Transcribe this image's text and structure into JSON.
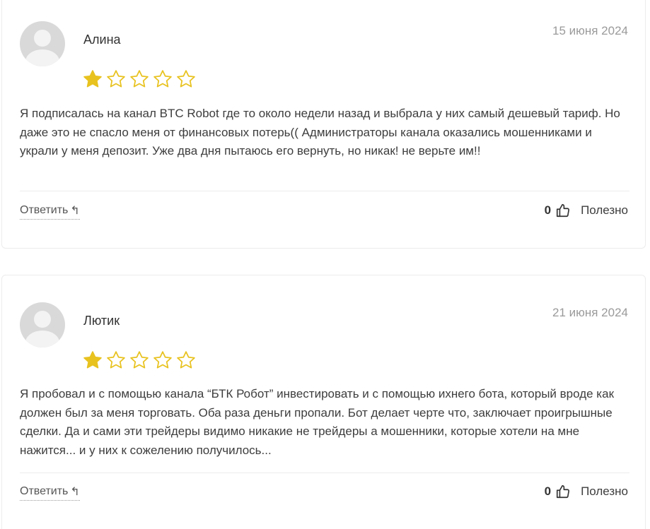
{
  "reviews": [
    {
      "author": "Алина",
      "date": "15 июня 2024",
      "rating": 1,
      "max_rating": 5,
      "text": "Я подписалась на канал BTC Robot где то около недели назад и выбрала у них самый дешевый тариф. Но даже это не спасло меня от финансовых потерь(( Администраторы канала оказались мошенниками и украли у меня депозит. Уже два дня пытаюсь его вернуть, но никак! не верьте им!!",
      "reply_label": "Ответить",
      "helpful_count": "0",
      "helpful_label": "Полезно"
    },
    {
      "author": "Лютик",
      "date": "21 июня 2024",
      "rating": 1,
      "max_rating": 5,
      "text": "Я пробовал и с помощью канала “БТК Робот” инвестировать и с помощью ихнего бота, который вроде как должен был за меня торговать. Оба раза деньги пропали. Бот делает черте что, заключает проигрышные сделки. Да и сами эти трейдеры видимо никакие не трейдеры а мошенники, которые хотели на мне нажится... и у них к сожелению получилось...",
      "reply_label": "Ответить",
      "helpful_count": "0",
      "helpful_label": "Полезно"
    }
  ],
  "icons": {
    "avatar": "user-placeholder-icon",
    "star_filled": "star-filled-icon",
    "star_empty": "star-outline-icon",
    "reply": "reply-arrow-icon",
    "helpful": "thumbs-up-icon"
  },
  "colors": {
    "star": "#e8c21f",
    "divider": "#ececec",
    "date": "#9a9a9a"
  }
}
